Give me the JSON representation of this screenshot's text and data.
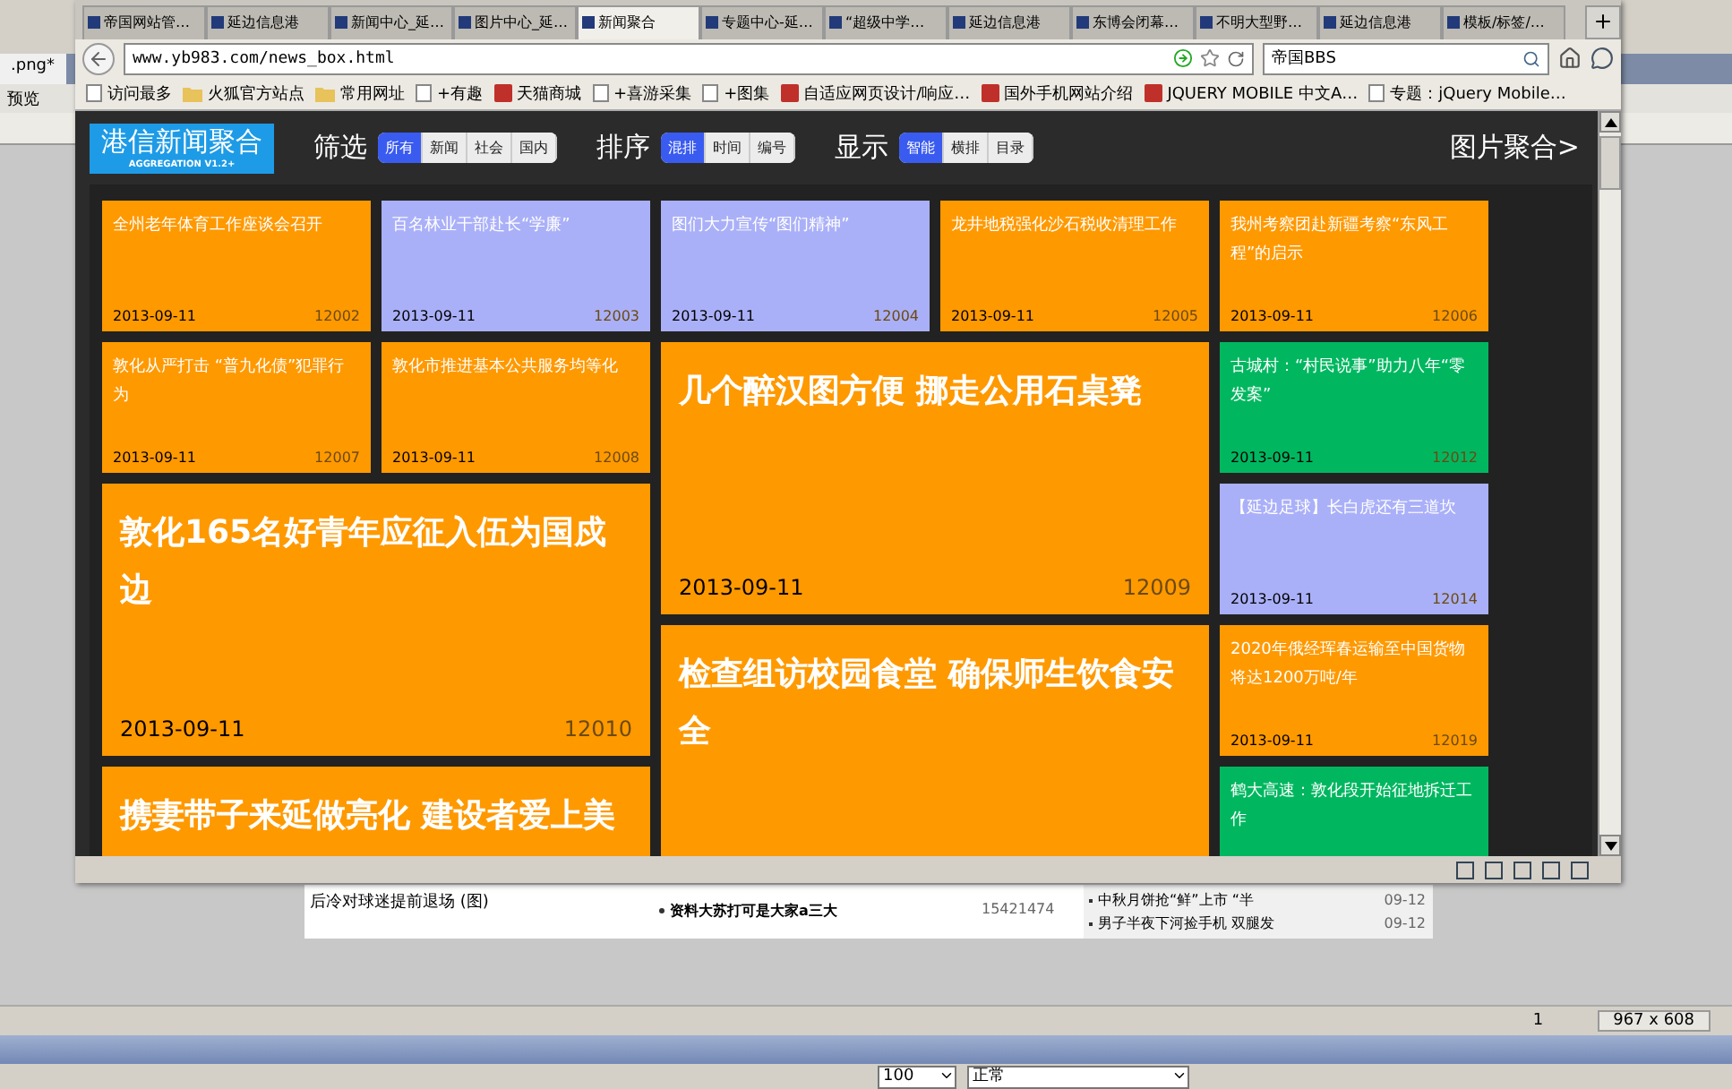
{
  "browser": {
    "tabs": [
      {
        "label": "帝国网站管…",
        "selected": false
      },
      {
        "label": "延边信息港",
        "selected": false
      },
      {
        "label": "新闻中心_延…",
        "selected": false
      },
      {
        "label": "图片中心_延…",
        "selected": false
      },
      {
        "label": "新闻聚合",
        "selected": true
      },
      {
        "label": "专题中心-延…",
        "selected": false
      },
      {
        "label": "“超级中学…",
        "selected": false
      },
      {
        "label": "延边信息港",
        "selected": false
      },
      {
        "label": "东博会闭幕…",
        "selected": false
      },
      {
        "label": "不明大型野…",
        "selected": false
      },
      {
        "label": "延边信息港",
        "selected": false
      },
      {
        "label": "模板/标签/…",
        "selected": false
      }
    ],
    "address": "www.yb983.com/news_box.html",
    "search": "帝国BBS",
    "bookmarks": [
      {
        "label": "访问最多",
        "kind": "page"
      },
      {
        "label": "火狐官方站点",
        "kind": "folder"
      },
      {
        "label": "常用网址",
        "kind": "folder"
      },
      {
        "label": "+有趣",
        "kind": "page"
      },
      {
        "label": "天猫商城",
        "kind": "app"
      },
      {
        "label": "+喜游采集",
        "kind": "page"
      },
      {
        "label": "+图集",
        "kind": "page"
      },
      {
        "label": "自适应网页设计/响应…",
        "kind": "app"
      },
      {
        "label": "国外手机网站介绍",
        "kind": "app"
      },
      {
        "label": "JQUERY MOBILE 中文A…",
        "kind": "app"
      },
      {
        "label": "专题：jQuery Mobile…",
        "kind": "page"
      }
    ]
  },
  "site": {
    "logo": {
      "title": "港信新闻聚合",
      "subtitle": "AGGREGATION",
      "version": "V1.2+"
    },
    "groups": [
      {
        "label": "筛选",
        "options": [
          {
            "label": "所有",
            "selected": true
          },
          {
            "label": "新闻",
            "selected": false
          },
          {
            "label": "社会",
            "selected": false
          },
          {
            "label": "国内",
            "selected": false
          }
        ]
      },
      {
        "label": "排序",
        "options": [
          {
            "label": "混排",
            "selected": true
          },
          {
            "label": "时间",
            "selected": false
          },
          {
            "label": "编号",
            "selected": false
          }
        ]
      },
      {
        "label": "显示",
        "options": [
          {
            "label": "智能",
            "selected": true
          },
          {
            "label": "横排",
            "selected": false
          },
          {
            "label": "目录",
            "selected": false
          }
        ]
      }
    ],
    "picture_link": "图片聚合>"
  },
  "tiles": [
    {
      "kind": "small",
      "color": "#ff9900",
      "title": "全州老年体育工作座谈会召开",
      "date": "2013-09-11",
      "id": "12002"
    },
    {
      "kind": "small",
      "color": "#aab0f8",
      "title": "百名林业干部赴长“学廉”",
      "date": "2013-09-11",
      "id": "12003"
    },
    {
      "kind": "small",
      "color": "#aab0f8",
      "title": "图们大力宣传“图们精神”",
      "date": "2013-09-11",
      "id": "12004"
    },
    {
      "kind": "small",
      "color": "#ff9900",
      "title": "龙井地税强化沙石税收清理工作",
      "date": "2013-09-11",
      "id": "12005"
    },
    {
      "kind": "small",
      "color": "#ff9900",
      "title": "我州考察团赴新疆考察“东风工程”的启示",
      "date": "2013-09-11",
      "id": "12006"
    },
    {
      "kind": "small",
      "color": "#ff9900",
      "title": "敦化从严打击 “普九化债”犯罪行为",
      "date": "2013-09-11",
      "id": "12007"
    },
    {
      "kind": "small",
      "color": "#ff9900",
      "title": "敦化市推进基本公共服务均等化",
      "date": "2013-09-11",
      "id": "12008"
    },
    {
      "kind": "large",
      "color": "#ff9900",
      "title": "几个醉汉图方便 挪走公用石桌凳",
      "date": "2013-09-11",
      "id": "12009"
    },
    {
      "kind": "small",
      "color": "#00b760",
      "title": "古城村：“村民说事”助力八年“零发案”",
      "date": "2013-09-11",
      "id": "12012"
    },
    {
      "kind": "large",
      "color": "#ff9900",
      "title": "敦化165名好青年应征入伍为国戍边",
      "date": "2013-09-11",
      "id": "12010"
    },
    {
      "kind": "small",
      "color": "#aab0f8",
      "title": "【延边足球】长白虎还有三道坎",
      "date": "2013-09-11",
      "id": "12014"
    },
    {
      "kind": "large",
      "color": "#ff9900",
      "title": "检查组访校园食堂 确保师生饮食安全"
    },
    {
      "kind": "small",
      "color": "#ff9900",
      "title": "2020年俄经珲春运输至中国货物将达1200万吨/年",
      "date": "2013-09-11",
      "id": "12019"
    },
    {
      "kind": "large",
      "color": "#ff9900",
      "title": "携妻带子来延做亮化 建设者爱上美"
    },
    {
      "kind": "small",
      "color": "#00b760",
      "title": "鹤大高速：敦化段开始征地拆迁工作"
    }
  ],
  "editor": {
    "file_tab": ".png*",
    "preview": "预览",
    "document": {
      "left": [
        "后冷对球迷提前退场 (图)"
      ],
      "middle": "资料大苏打可是大家a三大",
      "number": "15421474",
      "news": [
        {
          "title": "中秋月饼抢“鲜”上市 “半",
          "date": "09-12"
        },
        {
          "title": "男子半夜下河捡手机 双腿发",
          "date": "09-12"
        }
      ]
    },
    "page": "1",
    "size": "967 x 608",
    "zoom": "100",
    "blend": "正常"
  }
}
